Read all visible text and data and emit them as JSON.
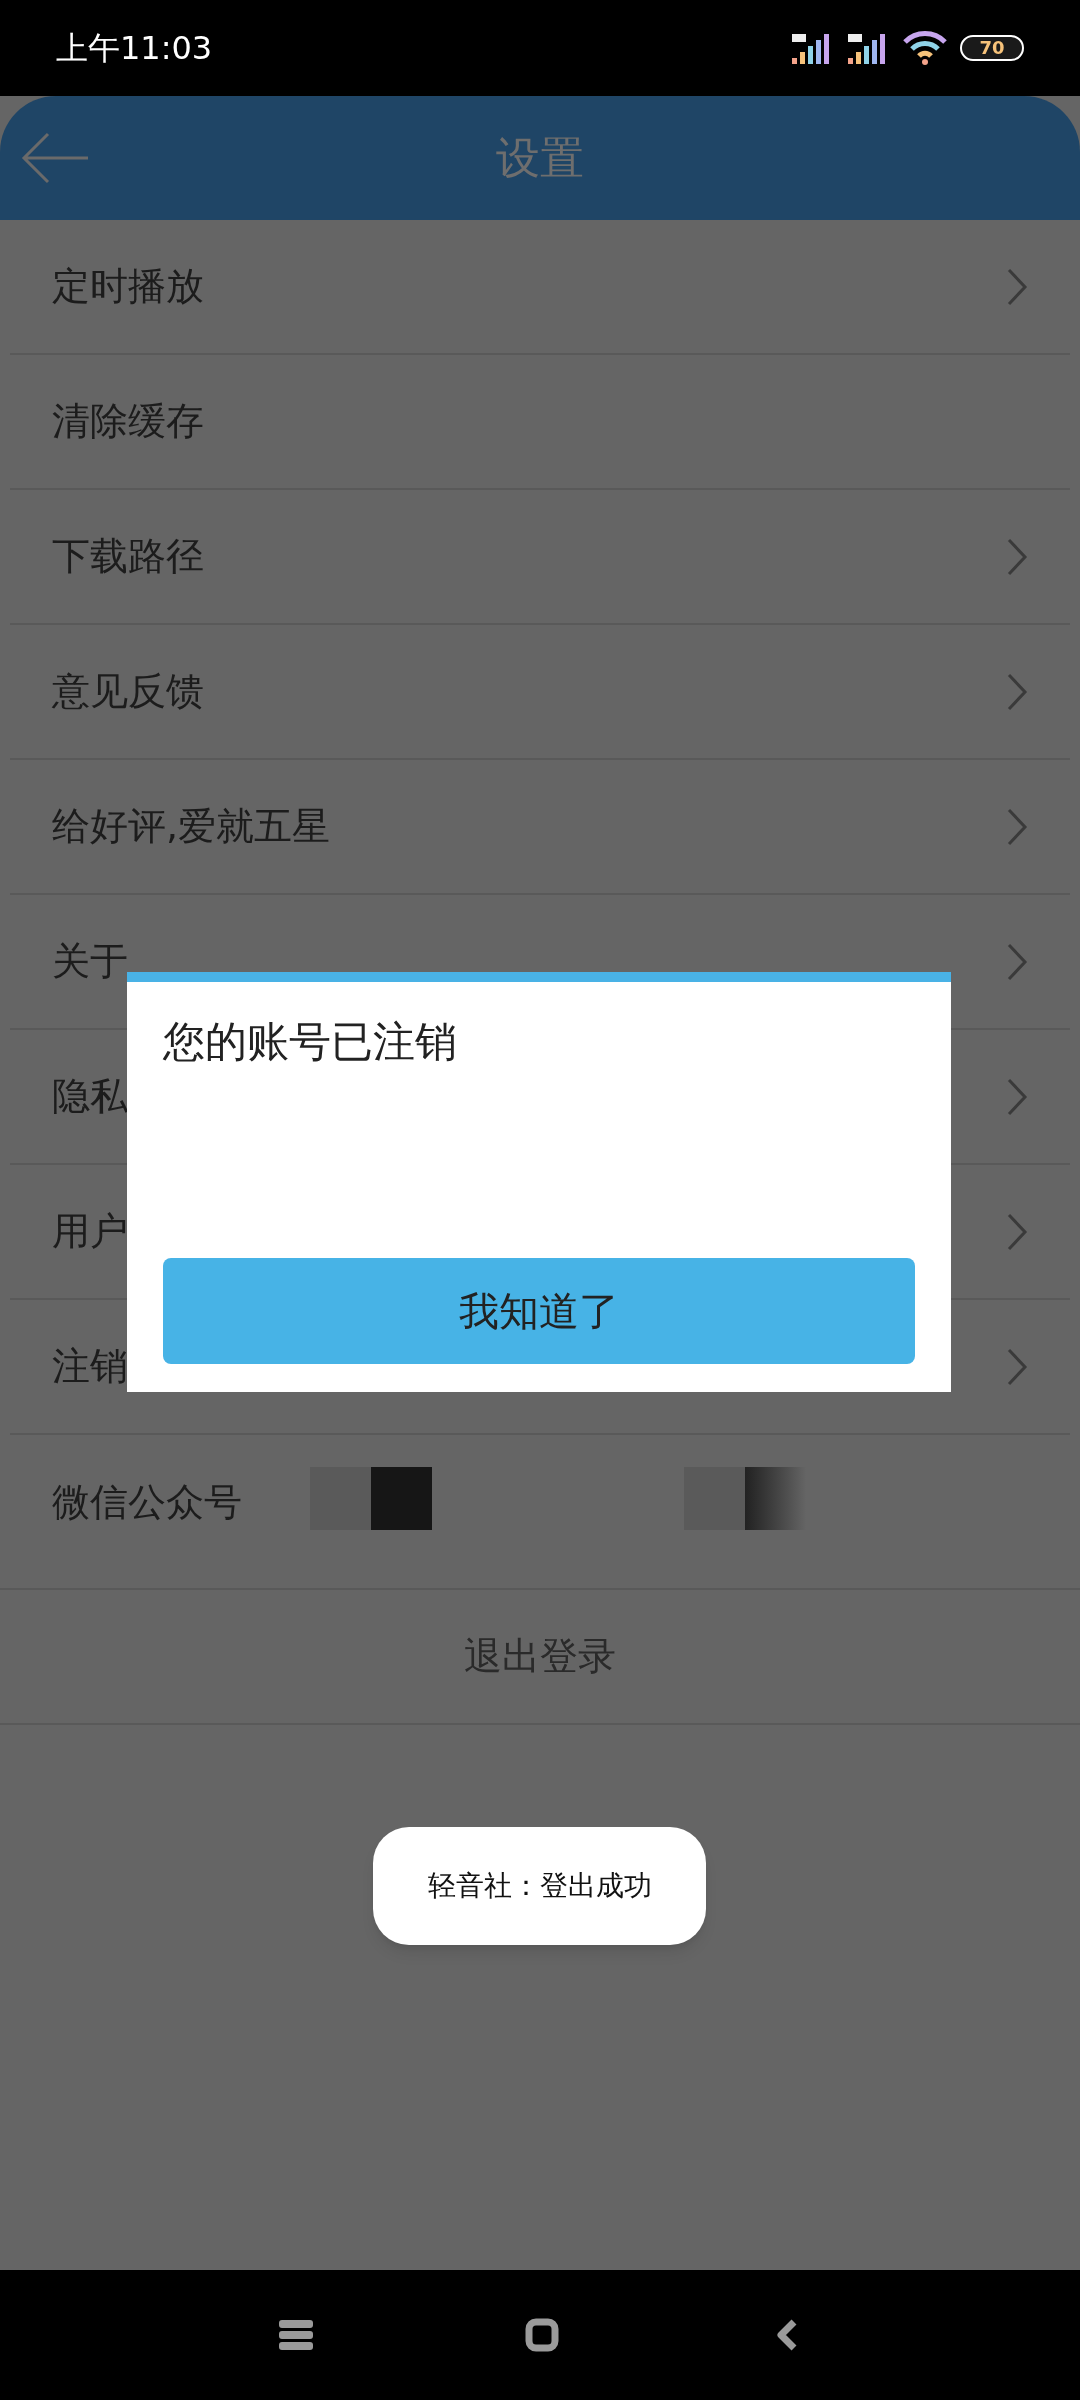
{
  "status_bar": {
    "time": "上午11:03",
    "battery": "70"
  },
  "header": {
    "title": "设置"
  },
  "settings": [
    {
      "label": "定时播放",
      "chevron": true
    },
    {
      "label": "清除缓存",
      "chevron": false
    },
    {
      "label": "下载路径",
      "chevron": true
    },
    {
      "label": "意见反馈",
      "chevron": true
    },
    {
      "label": "给好评,爱就五星",
      "chevron": true
    },
    {
      "label": "关于",
      "chevron": true
    },
    {
      "label": "隐私",
      "chevron": true
    },
    {
      "label": "用户",
      "chevron": true
    },
    {
      "label": "注销",
      "chevron": true
    }
  ],
  "wechat_row": {
    "label": "微信公众号"
  },
  "logout": {
    "label": "退出登录"
  },
  "dialog": {
    "message": "您的账号已注销",
    "button": "我知道了"
  },
  "toast": {
    "text": "轻音社：登出成功"
  }
}
